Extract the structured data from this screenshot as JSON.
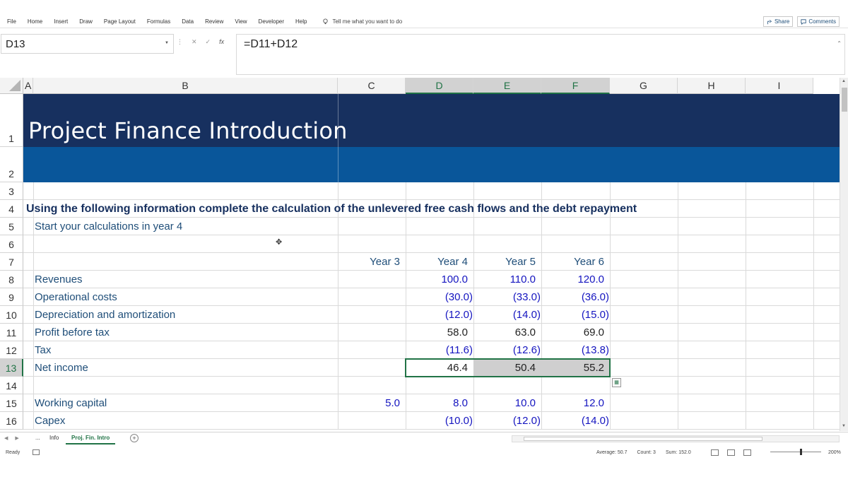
{
  "ribbon": {
    "tabs": [
      "File",
      "Home",
      "Insert",
      "Draw",
      "Page Layout",
      "Formulas",
      "Data",
      "Review",
      "View",
      "Developer",
      "Help"
    ],
    "tell_me": "Tell me what you want to do",
    "share": "Share",
    "comments": "Comments"
  },
  "formula_bar": {
    "name_box": "D13",
    "formula": "=D11+D12"
  },
  "columns": [
    "A",
    "B",
    "C",
    "D",
    "E",
    "F",
    "G",
    "H",
    "I"
  ],
  "rows": [
    "1",
    "2",
    "3",
    "4",
    "5",
    "6",
    "7",
    "8",
    "9",
    "10",
    "11",
    "12",
    "13",
    "14",
    "15",
    "16"
  ],
  "sheet": {
    "title": "Project Finance Introduction",
    "instruction": "Using the following information complete the calculation of the unlevered free cash flows and the debt repayment",
    "subinstruction": "Start your calculations in year 4",
    "year_headers": [
      "Year 3",
      "Year 4",
      "Year 5",
      "Year 6"
    ],
    "lines": [
      {
        "label": "Revenues",
        "c": "",
        "d": "100.0",
        "e": "110.0",
        "f": "120.0"
      },
      {
        "label": "Operational costs",
        "c": "",
        "d": "(30.0)",
        "e": "(33.0)",
        "f": "(36.0)"
      },
      {
        "label": "Depreciation and amortization",
        "c": "",
        "d": "(12.0)",
        "e": "(14.0)",
        "f": "(15.0)"
      },
      {
        "label": "Profit before tax",
        "c": "",
        "d": "58.0",
        "e": "63.0",
        "f": "69.0"
      },
      {
        "label": "Tax",
        "c": "",
        "d": "(11.6)",
        "e": "(12.6)",
        "f": "(13.8)"
      },
      {
        "label": "Net income",
        "c": "",
        "d": "46.4",
        "e": "50.4",
        "f": "55.2"
      },
      {
        "label": "",
        "c": "",
        "d": "",
        "e": "",
        "f": ""
      },
      {
        "label": "Working capital",
        "c": "5.0",
        "d": "8.0",
        "e": "10.0",
        "f": "12.0"
      },
      {
        "label": "Capex",
        "c": "",
        "d": "(10.0)",
        "e": "(12.0)",
        "f": "(14.0)"
      }
    ]
  },
  "sheet_tabs": {
    "ellipsis": "...",
    "tabs": [
      "Info",
      "Proj. Fin. Intro"
    ],
    "active": "Proj. Fin. Intro"
  },
  "status_bar": {
    "ready": "Ready",
    "average": "Average: 50.7",
    "count": "Count: 3",
    "sum": "Sum: 152.0",
    "zoom": "200%"
  }
}
